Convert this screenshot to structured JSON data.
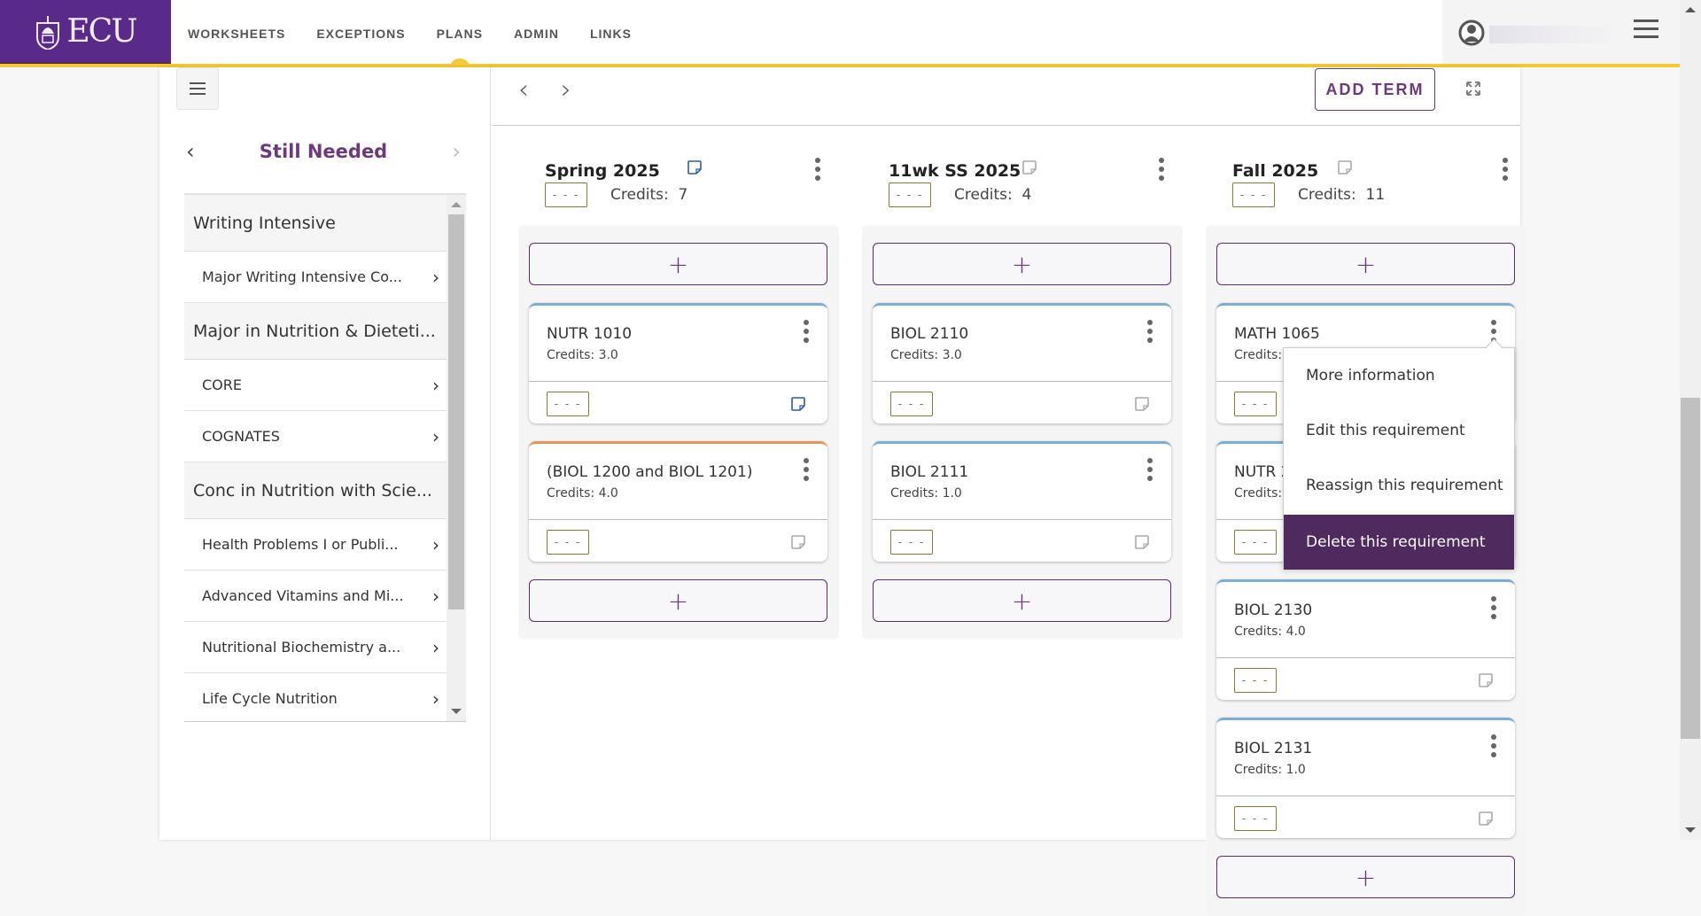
{
  "header": {
    "logo_text": "ECU",
    "nav": [
      {
        "label": "WORKSHEETS",
        "active": false
      },
      {
        "label": "EXCEPTIONS",
        "active": false
      },
      {
        "label": "PLANS",
        "active": true
      },
      {
        "label": "ADMIN",
        "active": false
      },
      {
        "label": "LINKS",
        "active": false
      }
    ],
    "user_icon": "user-circle-icon",
    "menu_icon": "hamburger-icon"
  },
  "colors": {
    "brand_purple": "#592a8a",
    "accent_gold": "#f5c934",
    "title_purple": "#6a3a7c",
    "menu_active_bg": "#4f2a5e",
    "card_border_blue": "#7aaed6",
    "card_border_orange": "#e8955a"
  },
  "sidebar": {
    "title": "Still Needed",
    "prev_icon": "chevron-left-icon",
    "next_icon": "chevron-right-icon",
    "items": [
      {
        "type": "group",
        "label": "Writing Intensive"
      },
      {
        "type": "item",
        "label": "Major Writing Intensive Co..."
      },
      {
        "type": "group",
        "label": "Major in Nutrition & Dieteti..."
      },
      {
        "type": "item",
        "label": "CORE"
      },
      {
        "type": "item",
        "label": "COGNATES"
      },
      {
        "type": "group",
        "label": "Conc in Nutrition with Scie..."
      },
      {
        "type": "item",
        "label": "Health Problems I or Publi..."
      },
      {
        "type": "item",
        "label": "Advanced Vitamins and Mi..."
      },
      {
        "type": "item",
        "label": "Nutritional Biochemistry a..."
      },
      {
        "type": "item",
        "label": "Life Cycle Nutrition"
      }
    ]
  },
  "toolbar": {
    "prev_icon": "chevron-left-icon",
    "next_icon": "chevron-right-icon",
    "add_term_label": "ADD TERM",
    "expand_icon": "expand-icon"
  },
  "grade_placeholder": "- - -",
  "add_symbol": "+",
  "terms": [
    {
      "title": "Spring 2025",
      "credits_label": "Credits:",
      "credits": "7",
      "note_active": true,
      "courses": [
        {
          "name": "NUTR 1010",
          "credits": "Credits: 3.0",
          "note_active": true,
          "border": "blue"
        },
        {
          "name": "(BIOL 1200 and BIOL 1201)",
          "credits": "Credits: 4.0",
          "note_active": false,
          "border": "orange"
        }
      ]
    },
    {
      "title": "11wk SS 2025",
      "credits_label": "Credits:",
      "credits": "4",
      "note_active": false,
      "courses": [
        {
          "name": "BIOL 2110",
          "credits": "Credits: 3.0",
          "note_active": false,
          "border": "blue"
        },
        {
          "name": "BIOL 2111",
          "credits": "Credits: 1.0",
          "note_active": false,
          "border": "blue"
        }
      ]
    },
    {
      "title": "Fall 2025",
      "credits_label": "Credits:",
      "credits": "11",
      "note_active": false,
      "courses": [
        {
          "name": "MATH 1065",
          "credits": "Credits:",
          "note_active": false,
          "border": "blue"
        },
        {
          "name": "NUTR 2",
          "credits": "Credits:",
          "note_active": false,
          "border": "blue"
        },
        {
          "name": "BIOL 2130",
          "credits": "Credits: 4.0",
          "note_active": false,
          "border": "blue"
        },
        {
          "name": "BIOL 2131",
          "credits": "Credits: 1.0",
          "note_active": false,
          "border": "blue"
        }
      ]
    }
  ],
  "context_menu": {
    "items": [
      {
        "label": "More information",
        "active": false
      },
      {
        "label": "Edit this requirement",
        "active": false
      },
      {
        "label": "Reassign this requirement",
        "active": false
      },
      {
        "label": "Delete this requirement",
        "active": true
      }
    ]
  }
}
